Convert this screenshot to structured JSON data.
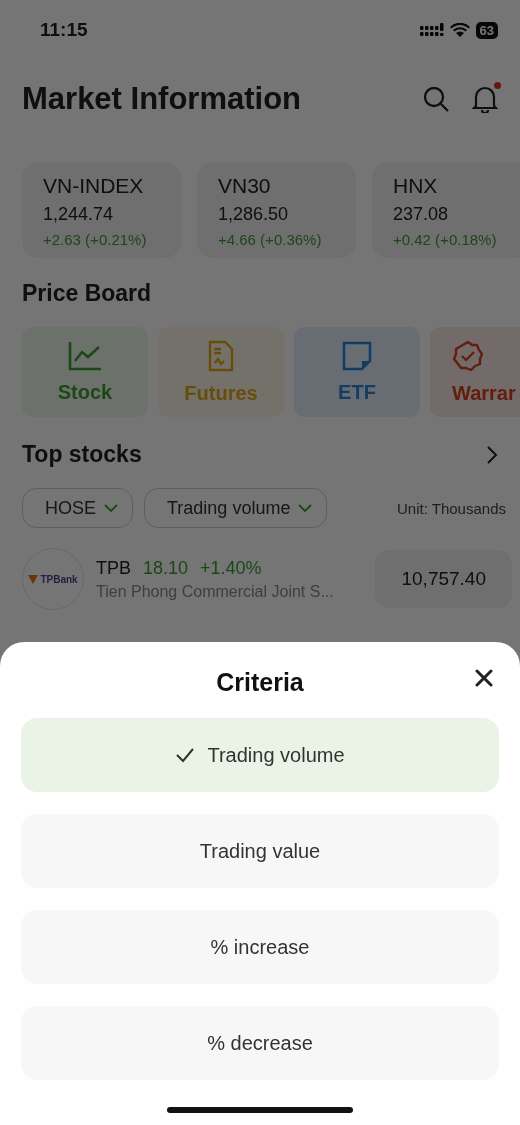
{
  "status_bar": {
    "time": "11:15",
    "battery": "63"
  },
  "header": {
    "title": "Market Information"
  },
  "indices": [
    {
      "name": "VN-INDEX",
      "value": "1,244.74",
      "change": "+2.63 (+0.21%)"
    },
    {
      "name": "VN30",
      "value": "1,286.50",
      "change": "+4.66 (+0.36%)"
    },
    {
      "name": "HNX",
      "value": "237.08",
      "change": "+0.42 (+0.18%)"
    }
  ],
  "price_board": {
    "title": "Price Board",
    "tiles": [
      {
        "label": "Stock",
        "kind": "chart"
      },
      {
        "label": "Futures",
        "kind": "document"
      },
      {
        "label": "ETF",
        "kind": "note"
      },
      {
        "label": "Warrar",
        "kind": "badge"
      }
    ]
  },
  "top_stocks": {
    "title": "Top stocks",
    "filters": [
      "HOSE",
      "Trading volume"
    ],
    "unit": "Unit: Thousands",
    "rows": [
      {
        "logo_text": "TPBank",
        "symbol": "TPB",
        "price": "18.10",
        "change": "+1.40%",
        "name": "Tien Phong Commercial Joint S...",
        "volume": "10,757.40"
      }
    ]
  },
  "sheet": {
    "title": "Criteria",
    "options": [
      {
        "label": "Trading volume",
        "selected": true
      },
      {
        "label": "Trading value",
        "selected": false
      },
      {
        "label": "% increase",
        "selected": false
      },
      {
        "label": "% decrease",
        "selected": false
      }
    ]
  }
}
